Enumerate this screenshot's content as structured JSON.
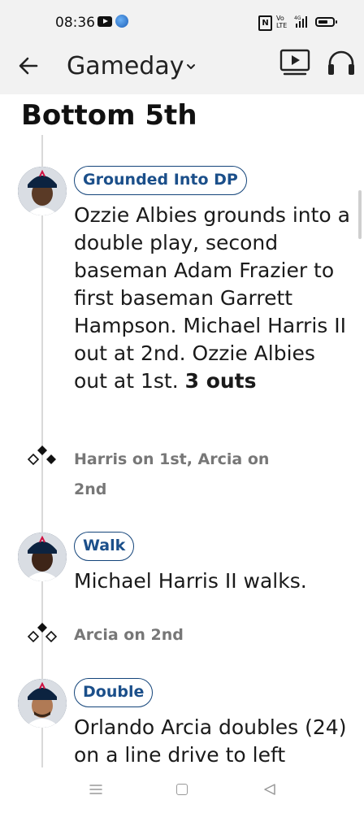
{
  "status_bar": {
    "time": "08:36",
    "icons": [
      "youtube-icon",
      "app-notification-icon",
      "nfc-icon",
      "volte-icon",
      "signal-4g-icon",
      "battery-icon"
    ],
    "volte_text_top": "Vo",
    "volte_text_bottom": "LTE",
    "signal_text": "4G"
  },
  "app_bar": {
    "back_icon": "arrow-left-icon",
    "title": "Gameday",
    "dropdown_icon": "chevron-down-icon",
    "actions": [
      "tv-play-icon",
      "headphones-icon"
    ]
  },
  "inning": {
    "title": "Bottom 5th"
  },
  "events": [
    {
      "type": "play",
      "badge": "Grounded Into DP",
      "text_plain": "Ozzie Albies grounds into a double play, second baseman Adam Frazier to first baseman Garrett Hampson. Michael Harris II out at 2nd. Ozzie Albies out at 1st.",
      "text_bold": "3 outs"
    },
    {
      "type": "runners",
      "text": "Harris on 1st, Arcia on 2nd",
      "bases_icon": "bases-diamond-icon"
    },
    {
      "type": "play",
      "badge": "Walk",
      "text_plain": "Michael Harris II walks.",
      "text_bold": ""
    },
    {
      "type": "runners",
      "text": "Arcia on 2nd",
      "bases_icon": "bases-diamond-icon"
    },
    {
      "type": "play",
      "badge": "Double",
      "text_plain": "Orlando Arcia doubles (24) on a line drive to left",
      "text_bold": ""
    }
  ],
  "colors": {
    "badge_border": "#13447a",
    "badge_text": "#1b4f8a",
    "runner_text": "#777777",
    "header_bg": "#f2f2f2"
  },
  "nav_bar": {
    "icons": [
      "menu-icon",
      "home-icon",
      "back-triangle-icon"
    ]
  }
}
